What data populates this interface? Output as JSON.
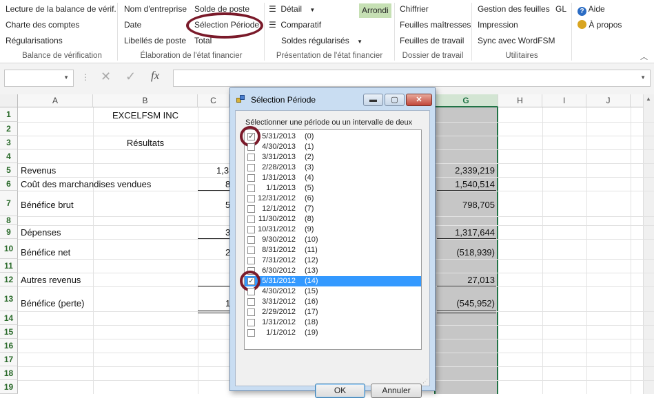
{
  "ribbon": {
    "col1": [
      "Lecture de la balance de vérif.",
      "Charte des comptes",
      "Régularisations"
    ],
    "col2a": [
      "Nom d'entreprise",
      "Date",
      "Libellés de poste"
    ],
    "col2b": [
      "Solde de poste",
      "Sélection Période",
      "Total"
    ],
    "col3a": [
      "Détail",
      "Comparatif",
      "Soldes régularisés"
    ],
    "col3b": "Arrondi",
    "col4": [
      "Chiffrier",
      "Feuilles maîtresses",
      "Feuilles de travail"
    ],
    "col5": [
      "Gestion des feuilles",
      "Impression",
      "Sync avec WordFSM"
    ],
    "col5b": "GL",
    "col6": [
      "Aide",
      "À propos"
    ],
    "groups": [
      "Balance de vérification",
      "Élaboration de l'état financier",
      "Présentation de l'état financier",
      "Dossier de travail",
      "Utilitaires"
    ]
  },
  "formula_bar": {
    "fx": "fx",
    "cancel": "✕",
    "enter": "✓"
  },
  "columns": [
    "A",
    "B",
    "C",
    "G",
    "H",
    "I",
    "J"
  ],
  "rows": [
    "1",
    "2",
    "3",
    "4",
    "5",
    "6",
    "7",
    "8",
    "9",
    "10",
    "11",
    "12",
    "13",
    "14",
    "15",
    "16",
    "17",
    "18",
    "19"
  ],
  "cells": {
    "b1": "EXCELFSM INC",
    "b3": "Résultats",
    "a5": "Revenus",
    "a6": "Coût des marchandises vendues",
    "a7": "Bénéfice brut",
    "a9": "Dépenses",
    "a10": "Bénéfice net",
    "a12": "Autres revenus",
    "a13": "Bénéfice (perte)",
    "c5": "1,3",
    "c6": "8",
    "c7": "5",
    "c9": "3",
    "c10": "2",
    "c13": "1",
    "g5": "2,339,219",
    "g6": "1,540,514",
    "g7": "798,705",
    "g9": "1,317,644",
    "g10": "(518,939)",
    "g12": "27,013",
    "g13": "(545,952)"
  },
  "dialog": {
    "title": "Sélection Période",
    "prompt": "Sélectionner une période ou un intervalle de deux",
    "items": [
      {
        "date": "5/31/2013",
        "idx": "(0)",
        "checked": true
      },
      {
        "date": "4/30/2013",
        "idx": "(1)"
      },
      {
        "date": "3/31/2013",
        "idx": "(2)"
      },
      {
        "date": "2/28/2013",
        "idx": "(3)"
      },
      {
        "date": "1/31/2013",
        "idx": "(4)"
      },
      {
        "date": "1/1/2013",
        "idx": "(5)"
      },
      {
        "date": "12/31/2012",
        "idx": "(6)"
      },
      {
        "date": "12/1/2012",
        "idx": "(7)"
      },
      {
        "date": "11/30/2012",
        "idx": "(8)"
      },
      {
        "date": "10/31/2012",
        "idx": "(9)"
      },
      {
        "date": "9/30/2012",
        "idx": "(10)"
      },
      {
        "date": "8/31/2012",
        "idx": "(11)"
      },
      {
        "date": "7/31/2012",
        "idx": "(12)"
      },
      {
        "date": "6/30/2012",
        "idx": "(13)"
      },
      {
        "date": "5/31/2012",
        "idx": "(14)",
        "checked": true,
        "selected": true
      },
      {
        "date": "4/30/2012",
        "idx": "(15)"
      },
      {
        "date": "3/31/2012",
        "idx": "(16)"
      },
      {
        "date": "2/29/2012",
        "idx": "(17)"
      },
      {
        "date": "1/31/2012",
        "idx": "(18)"
      },
      {
        "date": "1/1/2012",
        "idx": "(19)"
      }
    ],
    "ok": "OK",
    "cancel": "Annuler"
  }
}
